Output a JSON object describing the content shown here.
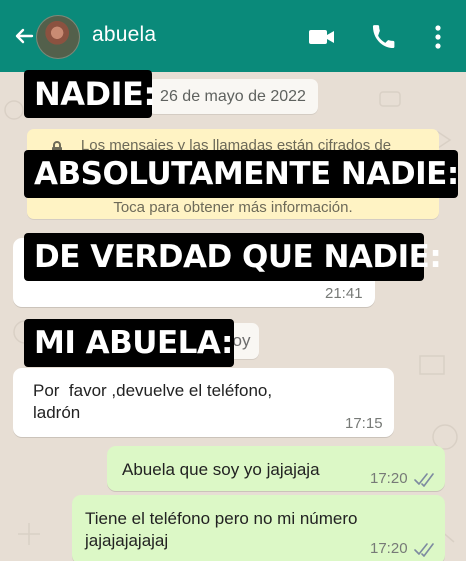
{
  "header": {
    "contact_name": "abuela"
  },
  "icons": {
    "back": "arrow-left-icon",
    "video": "video-call-icon",
    "call": "phone-icon",
    "menu": "more-vertical-icon",
    "lock": "lock-icon",
    "read": "double-check-icon"
  },
  "date_chip": "26 de mayo de 2022",
  "encryption": {
    "line1": "Los mensajes y las llamadas están cifrados de",
    "line2": "Toca para obtener más información."
  },
  "hidden_chip": {
    "text": "oy"
  },
  "meme_text": [
    "NADIE:",
    "ABSOLUTAMENTE NADIE:",
    "DE VERDAD QUE NADIE:",
    "MI ABUELA:"
  ],
  "messages": [
    {
      "text": "",
      "time": "21:41",
      "type": "incoming"
    },
    {
      "text": "Por  favor ,devuelve el teléfono,\nladrón",
      "time": "17:15",
      "type": "incoming"
    },
    {
      "text": "Abuela que soy yo jajajaja",
      "time": "17:20",
      "type": "outgoing"
    },
    {
      "text": "Tiene el teléfono pero no mi número\njajajajajajaj",
      "time": "17:20",
      "type": "outgoing"
    }
  ],
  "colors": {
    "header": "#0a8a7a",
    "chat_background": "#e7ded4",
    "incoming_bubble": "#ffffff",
    "outgoing_bubble": "#dcf8c6",
    "encryption_bubble": "#fff3c4",
    "read_ticks": "#7d8aa0"
  }
}
